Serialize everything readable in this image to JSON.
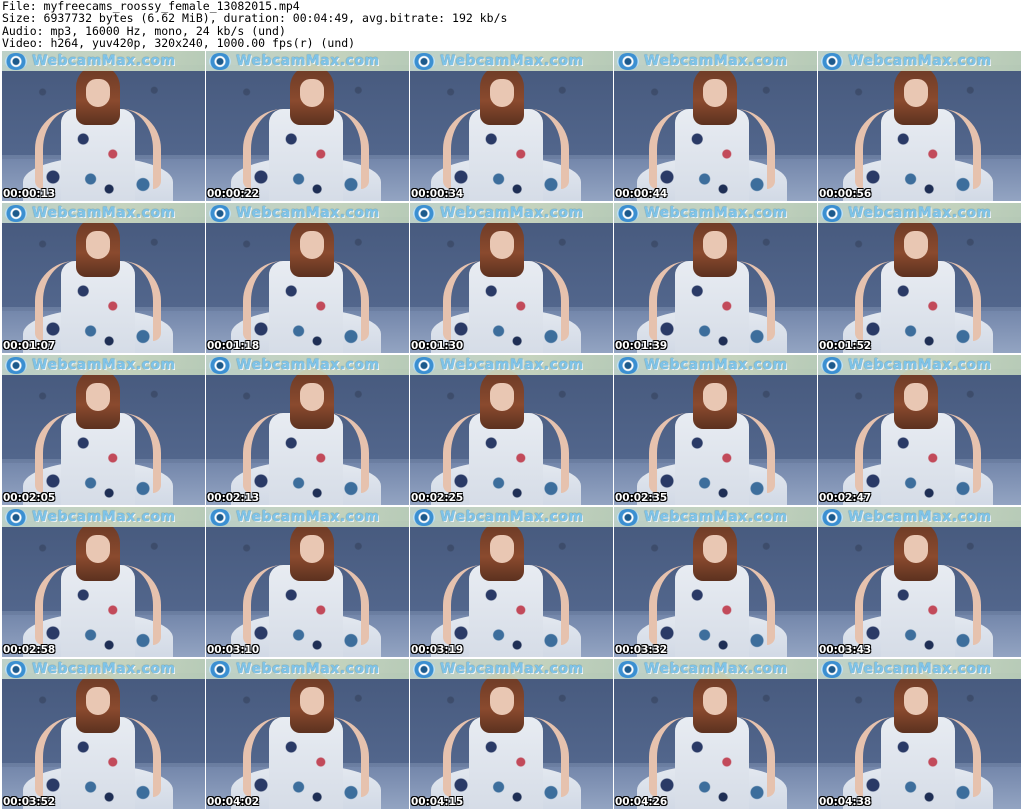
{
  "header": {
    "file_line": "File: myfreecams_roossy_female_13082015.mp4",
    "size_line": "Size: 6937732 bytes (6.62 MiB), duration: 00:04:49, avg.bitrate: 192 kb/s",
    "audio_line": "Audio: mp3, 16000 Hz, mono, 24 kb/s (und)",
    "video_line": "Video: h264, yuv420p, 320x240, 1000.00 fps(r) (und)"
  },
  "watermark_text": "WebcamMax.com",
  "thumbnails": [
    {
      "timestamp": "00:00:13"
    },
    {
      "timestamp": "00:00:22"
    },
    {
      "timestamp": "00:00:34"
    },
    {
      "timestamp": "00:00:44"
    },
    {
      "timestamp": "00:00:56"
    },
    {
      "timestamp": "00:01:07"
    },
    {
      "timestamp": "00:01:18"
    },
    {
      "timestamp": "00:01:30"
    },
    {
      "timestamp": "00:01:39"
    },
    {
      "timestamp": "00:01:52"
    },
    {
      "timestamp": "00:02:05"
    },
    {
      "timestamp": "00:02:13"
    },
    {
      "timestamp": "00:02:25"
    },
    {
      "timestamp": "00:02:35"
    },
    {
      "timestamp": "00:02:47"
    },
    {
      "timestamp": "00:02:58"
    },
    {
      "timestamp": "00:03:10"
    },
    {
      "timestamp": "00:03:19"
    },
    {
      "timestamp": "00:03:32"
    },
    {
      "timestamp": "00:03:43"
    },
    {
      "timestamp": "00:03:52"
    },
    {
      "timestamp": "00:04:02"
    },
    {
      "timestamp": "00:04:15"
    },
    {
      "timestamp": "00:04:26"
    },
    {
      "timestamp": "00:04:38"
    }
  ],
  "colors": {
    "hair": "#6b3a26",
    "sofa": "#4d5f82",
    "watermark": "#7fc4e8"
  }
}
